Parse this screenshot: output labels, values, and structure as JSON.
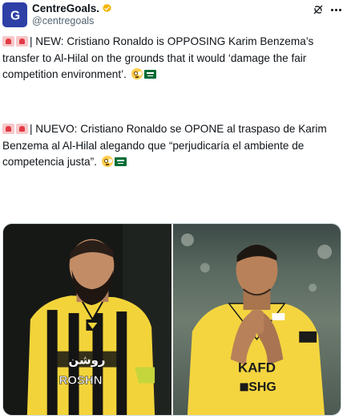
{
  "author": {
    "display_name": "CentreGoals.",
    "handle": "@centregoals",
    "avatar_letter": "G",
    "avatar_color": "#2e3fa6",
    "verified": true,
    "verified_color": "#f4b400"
  },
  "tweet": {
    "en_text": "| NEW: Cristiano Ronaldo is OPPOSING Karim Benzema’s transfer to Al-Hilal on the grounds that it would ‘damage the fair competition environment’.",
    "es_text": "| NUEVO: Cristiano Ronaldo se OPONE al traspaso de Karim Benzema al Al-Hilal alegando que “perjudicaría el ambiente de competencia justa”.",
    "emojis": [
      "rotating-light",
      "rotating-light",
      "flushed-face",
      "flag-saudi-arabia"
    ]
  },
  "media": {
    "photos": [
      {
        "subject": "footballer in yellow-black striped jersey",
        "jersey_text": "ROSHN",
        "jersey_script": "روشن"
      },
      {
        "subject": "footballer in yellow jersey applauding",
        "jersey_text": "KAFD",
        "jersey_text_2": "SHG"
      }
    ]
  }
}
